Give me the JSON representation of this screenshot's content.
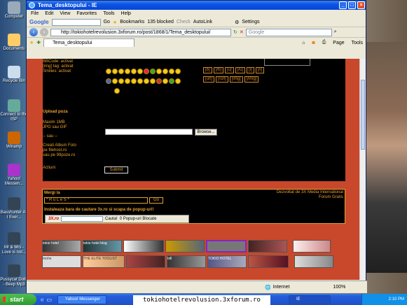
{
  "window": {
    "title": "Tema_desktopului - IE"
  },
  "menu": [
    "File",
    "Edit",
    "View",
    "Favorites",
    "Tools",
    "Help"
  ],
  "google_toolbar": {
    "brand": "Google",
    "go": "Go",
    "bookmarks": "Bookmarks",
    "blocked": "135 blocked",
    "check": "Check",
    "autolink": "AutoLink",
    "settings": "Settings"
  },
  "address": {
    "url": "http://tokiohotelrevolusion.3xforum.ro/post/1868/1/Tema_desktopului/",
    "search_placeholder": "Google"
  },
  "tab": {
    "label": "Tema_desktopului"
  },
  "commands": {
    "page": "Page",
    "tools": "Tools"
  },
  "post_form": {
    "bbcode": "BBCode: activat",
    "img_tag": "[img] tag: activat",
    "smilies": "Smilies: activat",
    "bb_buttons": [
      "[b]",
      "[/b]",
      "[u]",
      "[/u]",
      "[i]",
      "[/i]",
      "[url]",
      "[/url]",
      "[img]",
      "[/img]"
    ],
    "upload_title": "Upload poza",
    "maxim": "Maxim 1MB",
    "formats": "JPG sau GIF",
    "sau1": "-- sau --",
    "album1": "Creati Album Foto",
    "album2": "pe filehost.ro",
    "album3": "sau pe 99poze.ro",
    "browse": "Browse...",
    "actiuni": "Actiuni",
    "submit": "Submit"
  },
  "forum_footer": {
    "mergi": "Mergi la",
    "select_value": "* R u L e S *",
    "go": "Go",
    "dev1": "Dezvoltat de 3X Media International",
    "dev2": "Forum Gratis",
    "promo": "Instaleaza bara de cautare 3x.ro si scapa de popup-uri!",
    "brand": "3X.ro",
    "cauta": "Cauta!",
    "popup": "0 Popup-uri Blocate"
  },
  "banners": [
    "tokio hotel",
    "tokio hotel blog",
    "mohe",
    "bill",
    "TOKIO HOTEL",
    "THE ELITE TOOLIST"
  ],
  "status": {
    "zone": "Internet",
    "zoom": "100%"
  },
  "desktop_icons": [
    "Computer",
    "Documents",
    "Recycle Bin",
    "Connect to the ISP",
    "Winamp",
    "Yahoo! Messen...",
    "Basshunter All I Ever...",
    "Mr & Mrs - Love is not...",
    "Pussycat Dolls - Beep Mp3"
  ],
  "taskbar": {
    "start": "start",
    "yahoo": "Yahoo! Messenger",
    "ie": "IE",
    "time": "2:10 PM"
  },
  "caption": "tokiohotelrevolusion.3xforum.ro",
  "colors": {
    "accent": "#e8a030",
    "page_bg": "#c9472b",
    "panel": "#000000"
  }
}
